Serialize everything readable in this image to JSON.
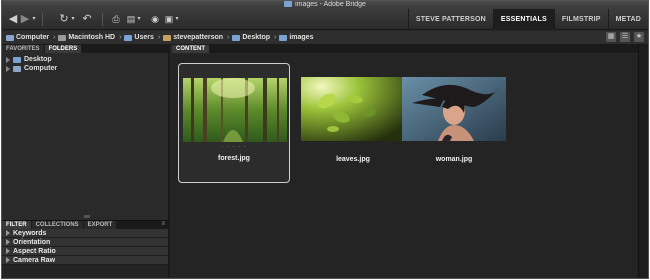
{
  "window": {
    "title": "images - Adobe Bridge"
  },
  "toolbar": {
    "workspaces": [
      "STEVE PATTERSON",
      "ESSENTIALS",
      "FILMSTRIP",
      "METAD"
    ],
    "active_workspace": "ESSENTIALS"
  },
  "path": {
    "crumbs": [
      {
        "label": "Computer",
        "icon": "computer-icon"
      },
      {
        "label": "Macintosh HD",
        "icon": "disk-icon"
      },
      {
        "label": "Users",
        "icon": "folder-icon"
      },
      {
        "label": "stevepatterson",
        "icon": "home-icon"
      },
      {
        "label": "Desktop",
        "icon": "folder-icon"
      },
      {
        "label": "images",
        "icon": "folder-icon"
      }
    ]
  },
  "left_top": {
    "tabs": [
      "FAVORITES",
      "FOLDERS"
    ],
    "active_tab": "FOLDERS",
    "tree": [
      "Desktop",
      "Computer"
    ]
  },
  "left_bottom": {
    "tabs": [
      "FILTER",
      "COLLECTIONS",
      "EXPORT"
    ],
    "active_tab": "FILTER",
    "filters": [
      "Keywords",
      "Orientation",
      "Aspect Ratio",
      "Camera Raw"
    ]
  },
  "content": {
    "tab": "CONTENT",
    "items": [
      {
        "name": "forest.jpg",
        "selected": true
      },
      {
        "name": "leaves.jpg",
        "selected": false
      },
      {
        "name": "woman.jpg",
        "selected": false
      }
    ],
    "rating_dots": "· · · · ·"
  },
  "colors": {
    "folder": "#7ba2d4",
    "panel_bg": "#262626",
    "workspace_active_bg": "#1e1e1e"
  }
}
